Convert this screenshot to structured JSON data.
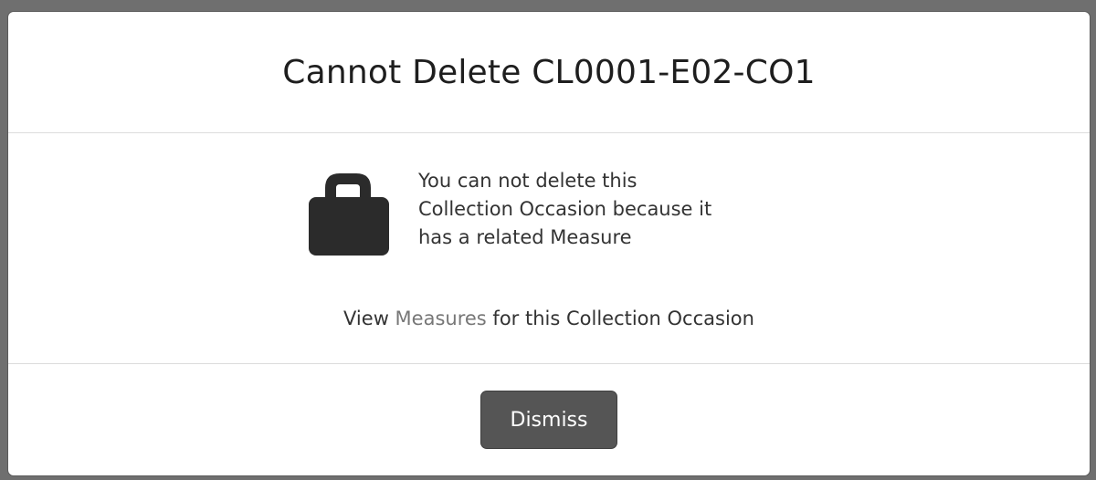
{
  "modal": {
    "title": "Cannot Delete CL0001-E02-CO1",
    "icon": "lock-icon",
    "message_lines": [
      "You can not delete this",
      "Collection Occasion because it",
      "has a related Measure"
    ],
    "view_prefix": "View ",
    "view_link": "Measures",
    "view_suffix": " for this Collection Occasion",
    "dismiss_label": "Dismiss"
  },
  "colors": {
    "backdrop": "#6f6f6f",
    "button": "#555555",
    "link": "#777777",
    "icon": "#2b2b2b"
  }
}
